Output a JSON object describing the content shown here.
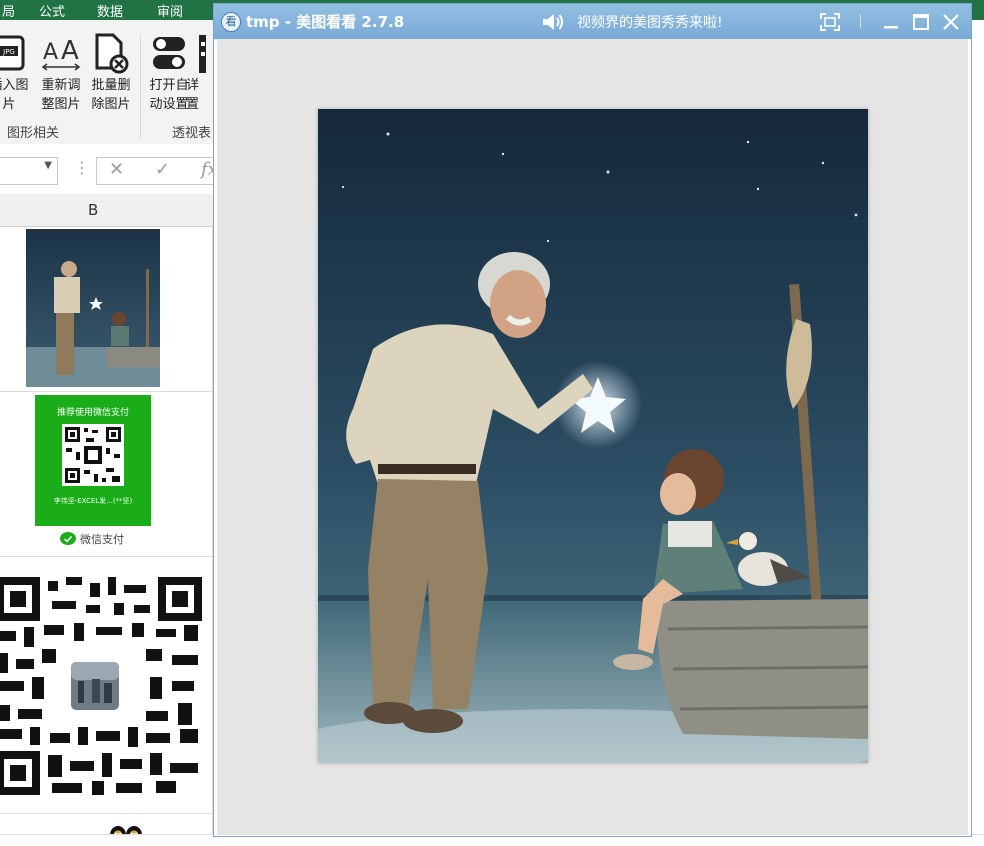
{
  "excel": {
    "menu": [
      "局",
      "公式",
      "数据",
      "审阅"
    ],
    "ribbon": {
      "buttons": [
        {
          "label": "插入图\n片",
          "icon": "jpg-icon"
        },
        {
          "label": "重新调\n整图片",
          "icon": "resize-font-icon"
        },
        {
          "label": "批量删\n除图片",
          "icon": "delete-file-icon"
        },
        {
          "label": "打开自\n动设置",
          "icon": "toggle-icon"
        },
        {
          "label": "详\n置",
          "icon": "detail-icon"
        }
      ],
      "groups": [
        "图形相关",
        "透视表"
      ]
    },
    "formula_bar": {
      "fx": "fx",
      "cancel": "✕",
      "confirm": "✓"
    },
    "column_header": "B",
    "wechat_card": {
      "title": "推荐使用微信支付",
      "caption": "李伟坚-EXCEL发...(**坚)",
      "pay_label": "微信支付"
    }
  },
  "viewer": {
    "title": "tmp - 美图看看 2.7.8",
    "slogan": "视频界的美图秀秀来啦!",
    "logo_char": "看",
    "colors": {
      "titlebar": "#86b6df",
      "client": "#e5e5e5",
      "excel_green": "#217346",
      "wechat_green": "#1aad19"
    }
  }
}
